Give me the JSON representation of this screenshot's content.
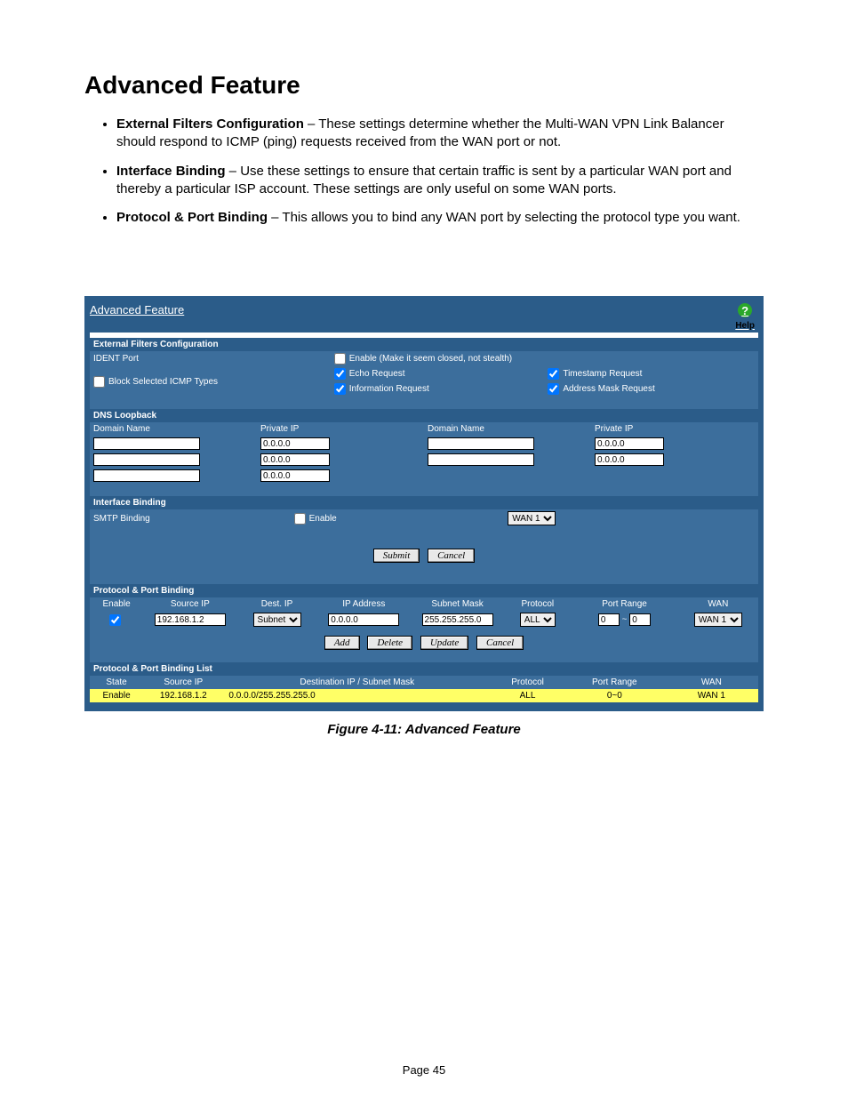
{
  "title": "Advanced Feature",
  "bullets": [
    {
      "label": "External Filters Configuration",
      "text": " – These settings determine whether the Multi-WAN VPN Link Balancer should respond to ICMP (ping) requests received from the WAN port or not."
    },
    {
      "label": "Interface Binding",
      "text": " – Use these settings to ensure that certain traffic is sent by a particular WAN port and thereby a particular ISP account. These settings are only useful on some WAN ports."
    },
    {
      "label": "Protocol & Port Binding",
      "text": " – This allows you to bind any WAN port by selecting the protocol type you want."
    }
  ],
  "shot": {
    "title": "Advanced Feature",
    "help": "Help",
    "ext_filters": {
      "header": "External Filters Configuration",
      "ident_port": "IDENT Port",
      "ident_enable": "Enable (Make it seem closed, not stealth)",
      "block_icmp": "Block Selected ICMP Types",
      "echo": "Echo Request",
      "info": "Information Request",
      "timestamp": "Timestamp Request",
      "addrmask": "Address Mask Request"
    },
    "dns": {
      "header": "DNS Loopback",
      "domain": "Domain Name",
      "private": "Private IP",
      "default_ip": "0.0.0.0"
    },
    "iface": {
      "header": "Interface Binding",
      "smtp": "SMTP Binding",
      "enable": "Enable",
      "wan": "WAN 1"
    },
    "buttons": {
      "submit": "Submit",
      "cancel": "Cancel",
      "add": "Add",
      "delete": "Delete",
      "update": "Update"
    },
    "ppb": {
      "header": "Protocol & Port Binding",
      "cols": {
        "enable": "Enable",
        "src": "Source IP",
        "dest": "Dest. IP",
        "ip": "IP Address",
        "mask": "Subnet Mask",
        "proto": "Protocol",
        "range": "Port Range",
        "wan": "WAN"
      },
      "row": {
        "src": "192.168.1.2",
        "dest": "Subnet",
        "ip": "0.0.0.0",
        "mask": "255.255.255.0",
        "proto": "ALL",
        "range_from": "0",
        "range_sep": "~",
        "range_to": "0",
        "wan": "WAN 1"
      }
    },
    "list": {
      "header": "Protocol & Port Binding List",
      "cols": {
        "state": "State",
        "src": "Source IP",
        "dest": "Destination IP / Subnet Mask",
        "proto": "Protocol",
        "range": "Port Range",
        "wan": "WAN"
      },
      "row": {
        "state": "Enable",
        "src": "192.168.1.2",
        "dest": "0.0.0.0/255.255.255.0",
        "proto": "ALL",
        "range": "0~0",
        "wan": "WAN 1"
      }
    }
  },
  "caption": "Figure 4-11: Advanced Feature",
  "page_num": "Page 45"
}
